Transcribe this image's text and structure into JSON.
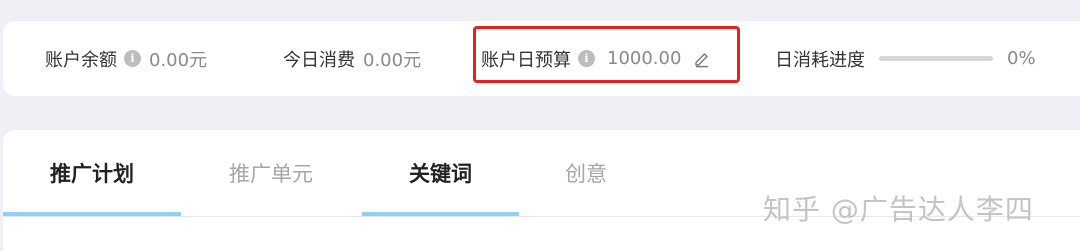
{
  "stats": {
    "balance": {
      "label": "账户余额",
      "value": "0.00元",
      "info_icon": "info-icon"
    },
    "today_spend": {
      "label": "今日消费",
      "value": "0.00元"
    },
    "daily_budget": {
      "label": "账户日预算",
      "value": "1000.00",
      "info_icon": "info-icon",
      "edit_icon": "pencil-icon",
      "highlighted": true,
      "highlight_color": "#e02424"
    },
    "daily_progress": {
      "label": "日消耗进度",
      "value_text": "0%",
      "fraction": 0
    }
  },
  "tabs": [
    {
      "label": "推广计划",
      "active": true,
      "underlined": true
    },
    {
      "label": "推广单元",
      "active": false,
      "underlined": false
    },
    {
      "label": "关键词",
      "active": true,
      "underlined": true
    },
    {
      "label": "创意",
      "active": false,
      "underlined": false
    }
  ],
  "watermark": "知乎 @广告达人李四",
  "colors": {
    "page_background": "#eef0f6",
    "card_background": "#ffffff",
    "tab_underline": "#90d2f6",
    "progress_track": "#d6d6d6"
  }
}
